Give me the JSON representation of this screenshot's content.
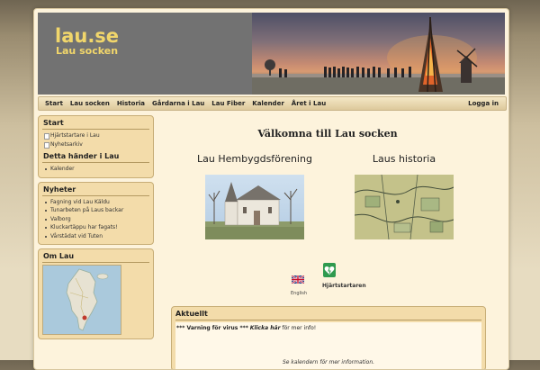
{
  "header": {
    "title": "lau.se",
    "subtitle": "Lau socken"
  },
  "nav": {
    "items": [
      "Start",
      "Lau socken",
      "Historia",
      "Gårdarna i Lau",
      "Lau Fiber",
      "Kalender",
      "Året i Lau"
    ],
    "login": "Logga in"
  },
  "sidebar": {
    "start": {
      "title": "Start",
      "items": [
        "Hjärtstartare i Lau",
        "Nyhetsarkiv"
      ]
    },
    "happening": {
      "title": "Detta händer i Lau",
      "items": [
        "Kalender"
      ]
    },
    "news": {
      "title": "Nyheter",
      "items": [
        "Fagning vid Lau Käldu",
        "Tunarbeten på Laus backar",
        "Valborg",
        "Kluckartäppu har fagats!",
        "Vårstädat vid Tuten"
      ]
    },
    "about": {
      "title": "Om Lau"
    }
  },
  "main": {
    "welcome": "Välkomna till Lau socken",
    "col1_title": "Lau Hembygdsförening",
    "col2_title": "Laus historia",
    "english_label": "English",
    "heart_label": "Hjärtstartaren"
  },
  "aktuellt": {
    "title": "Aktuellt",
    "warning_prefix": "*** Varning för virus ***",
    "warning_link": "Klicka här",
    "warning_suffix": "för mer info!",
    "calendar_note": "Se kalendern för mer information."
  },
  "colors": {
    "header_gray": "#727272",
    "title_yellow": "#f1d66b",
    "box_bg": "#f3dcaa"
  }
}
